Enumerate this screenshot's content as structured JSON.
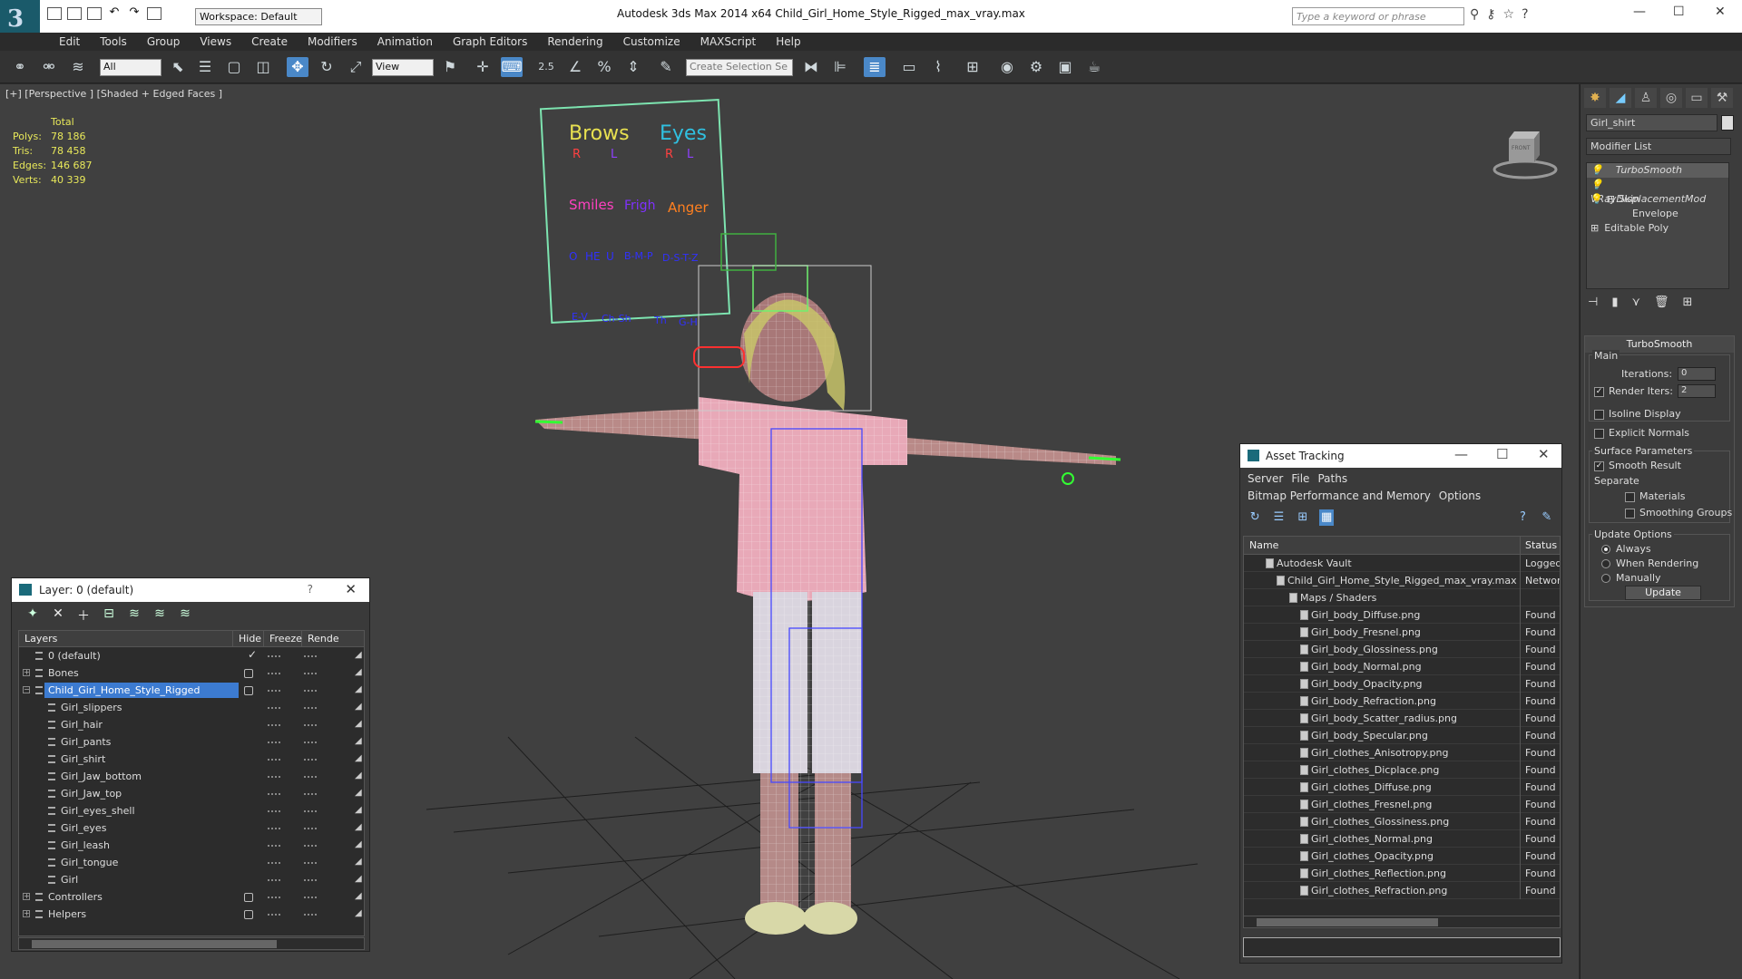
{
  "window": {
    "title": "Autodesk 3ds Max  2014 x64     Child_Girl_Home_Style_Rigged_max_vray.max",
    "workspace": "Workspace: Default",
    "search_placeholder": "Type a keyword or phrase",
    "minimize": "—",
    "maximize": "☐",
    "close": "✕"
  },
  "menu": [
    "Edit",
    "Tools",
    "Group",
    "Views",
    "Create",
    "Modifiers",
    "Animation",
    "Graph Editors",
    "Rendering",
    "Customize",
    "MAXScript",
    "Help"
  ],
  "toolbar": {
    "selection_filter": "All",
    "ref_coord": "View",
    "selection_set_placeholder": "Create Selection Se",
    "snap_angle": "2.5"
  },
  "viewport": {
    "label": "[+] [Perspective ] [Shaded + Edged Faces ]",
    "stats": {
      "header": "Total",
      "rows": [
        {
          "k": "Polys:",
          "v": "78 186"
        },
        {
          "k": "Tris:",
          "v": "78 458"
        },
        {
          "k": "Edges:",
          "v": "146 687"
        },
        {
          "k": "Verts:",
          "v": "40 339"
        }
      ]
    },
    "face_rig": {
      "brows": "Brows",
      "eyes": "Eyes",
      "r1": "R",
      "l1": "L",
      "r2": "R",
      "l2": "L",
      "smiles": "Smiles",
      "frigh": "Frigh",
      "anger": "Anger",
      "phon1": "O",
      "phon2": "HE",
      "phon3": "U",
      "phon4": "B-M-P",
      "phon5": "D-S-T-Z",
      "phon6": "E-V",
      "phon7": "Ch-Sh",
      "phon8": "Th",
      "phon9": "G-H"
    },
    "viewcube_label": "FRONT"
  },
  "command_panel": {
    "object_name": "Girl_shirt",
    "modifier_list": "Modifier List",
    "stack": [
      {
        "label": "TurboSmooth",
        "selected": true
      },
      {
        "label": "VRayDisplacementMod",
        "selected": false
      },
      {
        "label": "Skin",
        "selected": false
      },
      {
        "label": "Envelope",
        "selected": false
      },
      {
        "label": "Editable Poly",
        "selected": false
      }
    ],
    "turbosmooth": {
      "title": "TurboSmooth",
      "main": "Main",
      "iterations_label": "Iterations:",
      "iterations": "0",
      "render_iters_label": "Render Iters:",
      "render_iters": "2",
      "isoline": "Isoline Display",
      "explicit": "Explicit Normals",
      "surface_params": "Surface Parameters",
      "smooth_result": "Smooth Result",
      "separate": "Separate",
      "materials": "Materials",
      "smoothing_groups": "Smoothing Groups",
      "update_options": "Update Options",
      "always": "Always",
      "when_rendering": "When Rendering",
      "manually": "Manually",
      "update": "Update"
    }
  },
  "layer_window": {
    "title": "Layer: 0 (default)",
    "help": "?",
    "close": "✕",
    "columns": [
      "Layers",
      "Hide",
      "Freeze",
      "Rende"
    ],
    "rows": [
      {
        "name": "0 (default)",
        "indent": 0,
        "expand": "",
        "check": "✓",
        "hide": false,
        "sel": false
      },
      {
        "name": "Bones",
        "indent": 0,
        "expand": "+",
        "check": "",
        "hide": true,
        "sel": false
      },
      {
        "name": "Child_Girl_Home_Style_Rigged",
        "indent": 0,
        "expand": "−",
        "check": "",
        "hide": true,
        "sel": true
      },
      {
        "name": "Girl_slippers",
        "indent": 1,
        "expand": "",
        "check": "",
        "hide": false,
        "sel": false
      },
      {
        "name": "Girl_hair",
        "indent": 1,
        "expand": "",
        "check": "",
        "hide": false,
        "sel": false
      },
      {
        "name": "Girl_pants",
        "indent": 1,
        "expand": "",
        "check": "",
        "hide": false,
        "sel": false
      },
      {
        "name": "Girl_shirt",
        "indent": 1,
        "expand": "",
        "check": "",
        "hide": false,
        "sel": false
      },
      {
        "name": "Girl_Jaw_bottom",
        "indent": 1,
        "expand": "",
        "check": "",
        "hide": false,
        "sel": false
      },
      {
        "name": "Girl_Jaw_top",
        "indent": 1,
        "expand": "",
        "check": "",
        "hide": false,
        "sel": false
      },
      {
        "name": "Girl_eyes_shell",
        "indent": 1,
        "expand": "",
        "check": "",
        "hide": false,
        "sel": false
      },
      {
        "name": "Girl_eyes",
        "indent": 1,
        "expand": "",
        "check": "",
        "hide": false,
        "sel": false
      },
      {
        "name": "Girl_leash",
        "indent": 1,
        "expand": "",
        "check": "",
        "hide": false,
        "sel": false
      },
      {
        "name": "Girl_tongue",
        "indent": 1,
        "expand": "",
        "check": "",
        "hide": false,
        "sel": false
      },
      {
        "name": "Girl",
        "indent": 1,
        "expand": "",
        "check": "",
        "hide": false,
        "sel": false
      },
      {
        "name": "Controllers",
        "indent": 0,
        "expand": "+",
        "check": "",
        "hide": true,
        "sel": false
      },
      {
        "name": "Helpers",
        "indent": 0,
        "expand": "+",
        "check": "",
        "hide": true,
        "sel": false
      }
    ]
  },
  "asset_window": {
    "title": "Asset Tracking",
    "menu": [
      "Server",
      "File",
      "Paths",
      "Bitmap Performance and Memory",
      "Options"
    ],
    "columns": [
      "Name",
      "Status"
    ],
    "rows": [
      {
        "name": "Autodesk Vault",
        "status": "Logged",
        "indent": 0
      },
      {
        "name": "Child_Girl_Home_Style_Rigged_max_vray.max",
        "status": "Network",
        "indent": 1
      },
      {
        "name": "Maps / Shaders",
        "status": "",
        "indent": 2
      },
      {
        "name": "Girl_body_Diffuse.png",
        "status": "Found",
        "indent": 3
      },
      {
        "name": "Girl_body_Fresnel.png",
        "status": "Found",
        "indent": 3
      },
      {
        "name": "Girl_body_Glossiness.png",
        "status": "Found",
        "indent": 3
      },
      {
        "name": "Girl_body_Normal.png",
        "status": "Found",
        "indent": 3
      },
      {
        "name": "Girl_body_Opacity.png",
        "status": "Found",
        "indent": 3
      },
      {
        "name": "Girl_body_Refraction.png",
        "status": "Found",
        "indent": 3
      },
      {
        "name": "Girl_body_Scatter_radius.png",
        "status": "Found",
        "indent": 3
      },
      {
        "name": "Girl_body_Specular.png",
        "status": "Found",
        "indent": 3
      },
      {
        "name": "Girl_clothes_Anisotropy.png",
        "status": "Found",
        "indent": 3
      },
      {
        "name": "Girl_clothes_Dicplace.png",
        "status": "Found",
        "indent": 3
      },
      {
        "name": "Girl_clothes_Diffuse.png",
        "status": "Found",
        "indent": 3
      },
      {
        "name": "Girl_clothes_Fresnel.png",
        "status": "Found",
        "indent": 3
      },
      {
        "name": "Girl_clothes_Glossiness.png",
        "status": "Found",
        "indent": 3
      },
      {
        "name": "Girl_clothes_Normal.png",
        "status": "Found",
        "indent": 3
      },
      {
        "name": "Girl_clothes_Opacity.png",
        "status": "Found",
        "indent": 3
      },
      {
        "name": "Girl_clothes_Reflection.png",
        "status": "Found",
        "indent": 3
      },
      {
        "name": "Girl_clothes_Refraction.png",
        "status": "Found",
        "indent": 3
      }
    ]
  }
}
